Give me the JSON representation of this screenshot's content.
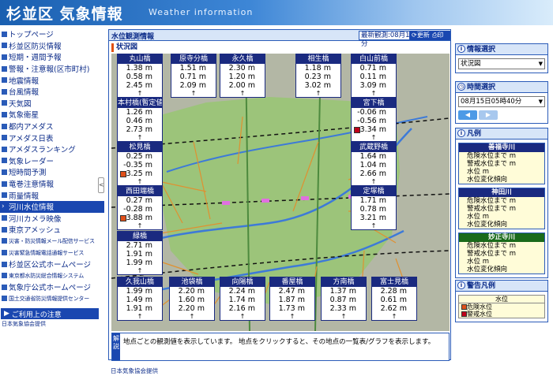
{
  "header": {
    "title": "杉並区 気象情報",
    "subtitle": "Weather information"
  },
  "sidebar": {
    "items": [
      {
        "label": "トップページ"
      },
      {
        "label": "杉並区防災情報"
      },
      {
        "label": "短期・週間予報"
      },
      {
        "label": "警報・注意報(区市町村)"
      },
      {
        "label": "地震情報"
      },
      {
        "label": "台風情報"
      },
      {
        "label": "天気図"
      },
      {
        "label": "気象衛星"
      },
      {
        "label": "都内アメダス"
      },
      {
        "label": "アメダス日表"
      },
      {
        "label": "アメダスランキング"
      },
      {
        "label": "気象レーダー"
      },
      {
        "label": "短時間予測"
      },
      {
        "label": "竜巻注意情報"
      },
      {
        "label": "雨量情報"
      },
      {
        "label": "河川水位情報"
      },
      {
        "label": "河川カメラ映像"
      },
      {
        "label": "東京アメッシュ"
      },
      {
        "label": "災害・防災情報メール配信サービス"
      },
      {
        "label": "災害緊急情報電話通報サービス"
      },
      {
        "label": "杉並区公式ホームページ"
      },
      {
        "label": "東京都水防災総合情報システム"
      },
      {
        "label": "気象庁公式ホームページ"
      },
      {
        "label": "国土交通省防災情報提供センター"
      }
    ],
    "notice_label": "ご利用上の注意",
    "credit": "日本気象協会提供"
  },
  "main": {
    "title": "水位観測情報",
    "latest": "最新観測:08月15日05時40分",
    "refresh_label": "更新",
    "print_label": "印刷",
    "section": "状況図",
    "explain_tag": "解説",
    "explain_text": "地点ごとの観測値を表示しています。 地点をクリックすると、その地点の一覧表/グラフを表示します。",
    "footer_credit": "日本気象協会提供",
    "road_number": "20"
  },
  "colors": {
    "zenpukuji": "#1a2a80",
    "kanda": "#1a2a80",
    "myoshoji": "#1a6a1a",
    "alert_danger": "#e0501a",
    "alert_warning": "#c0001a"
  },
  "stations": [
    {
      "name": "丸山橋",
      "v1": "1.38 m",
      "v2": "0.58 m",
      "v3": "2.45 m",
      "trend": "↑",
      "alert": null
    },
    {
      "name": "原寺分橋",
      "v1": "1.51 m",
      "v2": "0.71 m",
      "v3": "2.09 m",
      "trend": "↑",
      "alert": null
    },
    {
      "name": "永久橋",
      "v1": "2.30 m",
      "v2": "1.20 m",
      "v3": "2.00 m",
      "trend": "↑",
      "alert": null
    },
    {
      "name": "相生橋",
      "v1": "1.18 m",
      "v2": "0.23 m",
      "v3": "3.02 m",
      "trend": "↑",
      "alert": null
    },
    {
      "name": "白山前橋",
      "v1": "0.71 m",
      "v2": "0.11 m",
      "v3": "3.09 m",
      "trend": "↑",
      "alert": null
    },
    {
      "name": "本村橋(暫定値)",
      "v1": "1.26 m",
      "v2": "0.46 m",
      "v3": "2.73 m",
      "trend": "↑",
      "alert": null
    },
    {
      "name": "宮下橋",
      "v1": "-0.06 m",
      "v2": "-0.56 m",
      "v3": "3.34 m",
      "trend": "↑",
      "alert": "warning"
    },
    {
      "name": "松見橋",
      "v1": "0.25 m",
      "v2": "-0.35 m",
      "v3": "3.25 m",
      "trend": "↑",
      "alert": "danger"
    },
    {
      "name": "武蔵野橋",
      "v1": "1.64 m",
      "v2": "1.04 m",
      "v3": "2.66 m",
      "trend": "↑",
      "alert": null
    },
    {
      "name": "西田端橋",
      "v1": "0.27 m",
      "v2": "-0.28 m",
      "v3": "3.88 m",
      "trend": "↑",
      "alert": "danger"
    },
    {
      "name": "定塚橋",
      "v1": "1.71 m",
      "v2": "0.78 m",
      "v3": "3.21 m",
      "trend": "↑",
      "alert": null
    },
    {
      "name": "緑橋",
      "v1": "2.71 m",
      "v2": "1.91 m",
      "v3": "1.99 m",
      "trend": "↑",
      "alert": null
    },
    {
      "name": "久我山橋",
      "v1": "1.99 m",
      "v2": "1.49 m",
      "v3": "1.91 m",
      "trend": "↑",
      "alert": null
    },
    {
      "name": "池袋橋",
      "v1": "2.20 m",
      "v2": "1.60 m",
      "v3": "2.20 m",
      "trend": "↑",
      "alert": null
    },
    {
      "name": "向陽橋",
      "v1": "2.24 m",
      "v2": "1.74 m",
      "v3": "2.16 m",
      "trend": "↑",
      "alert": null
    },
    {
      "name": "番屋橋",
      "v1": "2.47 m",
      "v2": "1.87 m",
      "v3": "1.73 m",
      "trend": "↑",
      "alert": null
    },
    {
      "name": "方南橋",
      "v1": "1.37 m",
      "v2": "0.87 m",
      "v3": "2.33 m",
      "trend": "↑",
      "alert": null
    },
    {
      "name": "富士見橋",
      "v1": "2.28 m",
      "v2": "0.61 m",
      "v3": "2.62 m",
      "trend": "↑",
      "alert": null
    }
  ],
  "right_panel": {
    "info_title": "情報選択",
    "info_value": "状況図",
    "time_title": "時間選択",
    "time_value": "08月15日05時40分",
    "prev_label": "◀",
    "next_label": "▶",
    "legend_title": "凡例",
    "legend_groups": [
      {
        "title": "善福寺川",
        "lines": [
          "危険水位まで m",
          "警戒水位まで m",
          "水位 m",
          "水位変化傾向"
        ]
      },
      {
        "title": "神田川",
        "lines": [
          "危険水位まで m",
          "警戒水位まで m",
          "水位 m",
          "水位変化傾向"
        ]
      },
      {
        "title": "妙正寺川",
        "lines": [
          "危険水位まで m",
          "警戒水位まで m",
          "水位 m",
          "水位変化傾向"
        ]
      }
    ],
    "warning_title": "警告凡例",
    "warning_header": "水位",
    "warning_items": [
      "危険水位",
      "警戒水位"
    ]
  }
}
